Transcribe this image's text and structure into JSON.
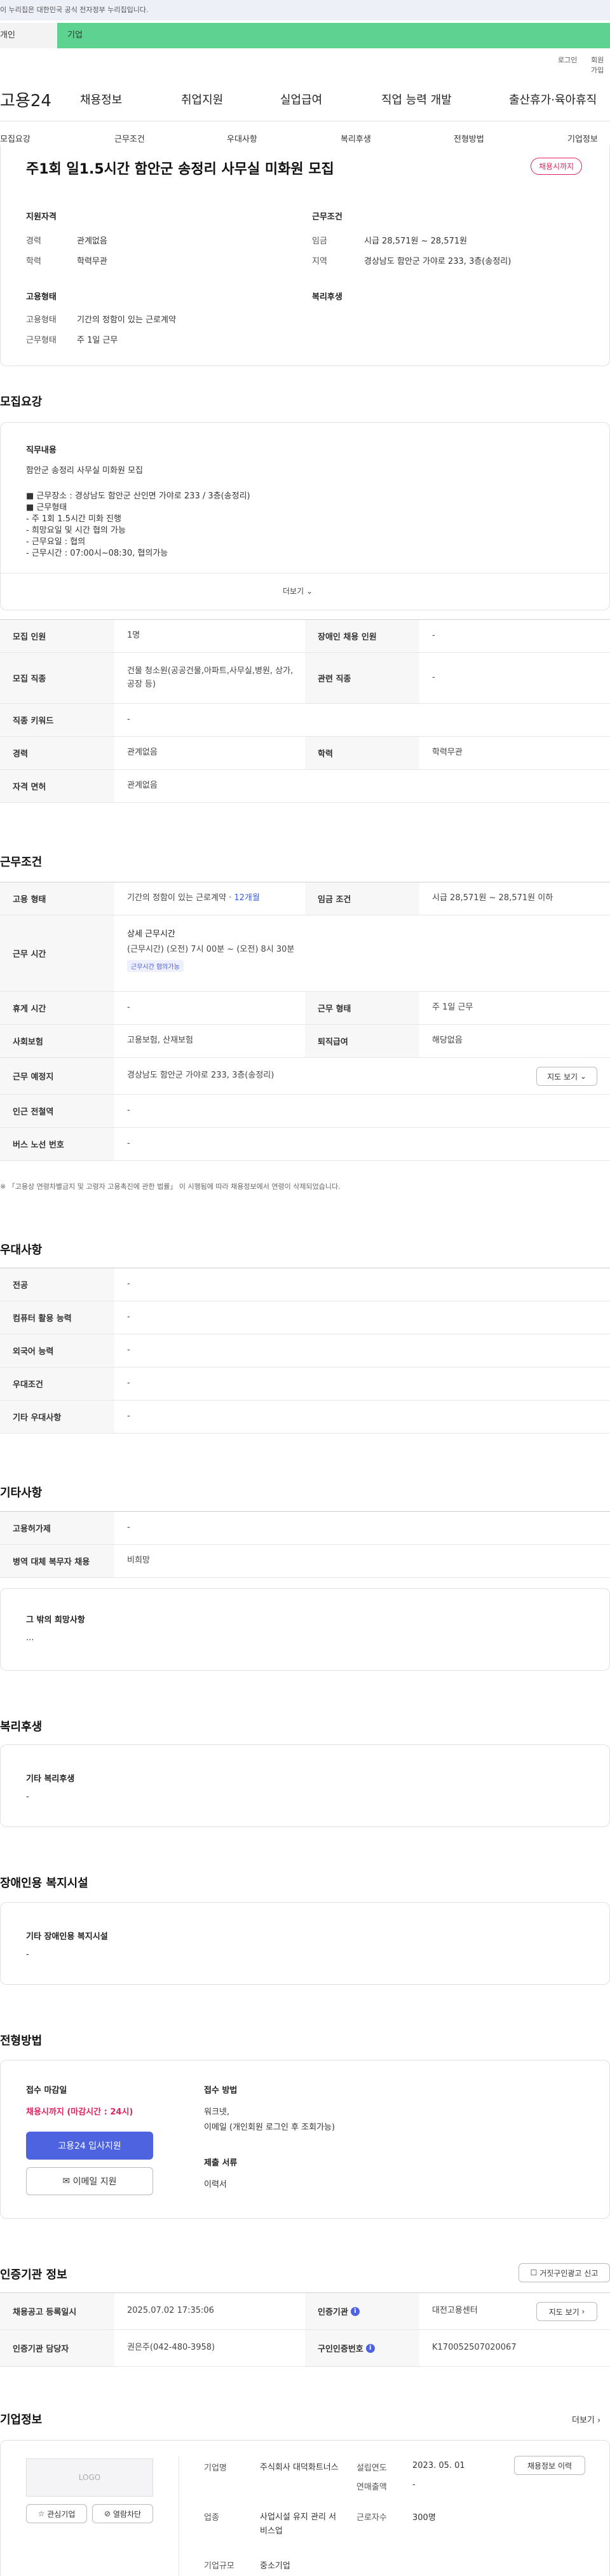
{
  "gov_banner": "이 누리집은 대한민국 공식 전자정부 누리집입니다.",
  "top_tabs": [
    "개인",
    "기업"
  ],
  "util": {
    "login": "로그인",
    "signup": "회원가입"
  },
  "logo": "고용24",
  "gnb": [
    "채용정보",
    "취업지원",
    "실업급여",
    "직업 능력 개발",
    "출산휴가·육아휴직"
  ],
  "sub_tabs": [
    "모집요강",
    "근무조건",
    "우대사항",
    "복리후생",
    "전형방법",
    "기업정보"
  ],
  "job": {
    "title": "주1회 일1.5시간 함안군 송정리 사무실 미화원 모집",
    "badge": "채용시까지",
    "summary": {
      "qual_head": "지원자격",
      "qual": [
        {
          "k": "경력",
          "v": "관계없음"
        },
        {
          "k": "학력",
          "v": "학력무관"
        }
      ],
      "cond_head": "근무조건",
      "cond": [
        {
          "k": "임금",
          "v": "시급 28,571원 ~ 28,571원"
        },
        {
          "k": "지역",
          "v": "경상남도 함안군 가야로 233, 3층(송정리)"
        }
      ],
      "emp_head": "고용형태",
      "emp": [
        {
          "k": "고용형태",
          "v": "기간의 정함이 있는 근로계약"
        },
        {
          "k": "근무형태",
          "v": "주 1일 근무"
        }
      ],
      "welfare_head": "복리후생"
    }
  },
  "recruit": {
    "title": "모집요강",
    "duty_head": "직무내용",
    "duty_lines": [
      "함안군 송정리 사무실 미화원 모집",
      "",
      "■ 근무장소 : 경상남도 함안군 산인면 가야로 233 / 3층(송정리)",
      "■ 근무형태",
      "- 주 1회 1.5시간 미화 진행",
      "- 희망요일 및 시간 협의 가능",
      "- 근무요일 : 협의",
      "- 근무시간 : 07:00시~08:30, 협의가능"
    ],
    "more": "더보기",
    "rows": [
      {
        "k1": "모집 인원",
        "v1": "1명",
        "k2": "장애인 채용 인원",
        "v2": "-"
      },
      {
        "k1": "모집 직종",
        "v1": "건물 청소원(공공건물,아파트,사무실,병원, 상가,공장 등)",
        "k2": "관련 직종",
        "v2": "-"
      },
      {
        "k1": "직종 키워드",
        "v1": "-"
      },
      {
        "k1": "경력",
        "v1": "관계없음",
        "k2": "학력",
        "v2": "학력무관"
      },
      {
        "k1": "자격 면허",
        "v1": "관계없음"
      }
    ]
  },
  "conditions": {
    "title": "근무조건",
    "emp_type_k": "고용 형태",
    "emp_type_v": "기간의 정함이 있는 근로계약",
    "emp_type_dur": "12개월",
    "wage_k": "임금 조건",
    "wage_v": "시급 28,571원 ~ 28,571원 이하",
    "hours_k": "근무 시간",
    "hours_head": "상세 근무시간",
    "hours_v": "(근무시간) (오전) 7시 00분 ~ (오전) 8시 30분",
    "hours_tag": "근무시간 협의가능",
    "rest_k": "휴게 시간",
    "rest_v": "-",
    "shift_k": "근무 형태",
    "shift_v": "주 1일 근무",
    "ins_k": "사회보험",
    "ins_v": "고용보험, 산재보험",
    "sev_k": "퇴직급여",
    "sev_v": "해당없음",
    "loc_k": "근무 예정지",
    "loc_v": "경상남도 함안군 가야로 233, 3층(송정리)",
    "map_btn": "지도 보기",
    "subway_k": "인근 전철역",
    "subway_v": "-",
    "bus_k": "버스 노선 번호",
    "bus_v": "-",
    "note": "※ 「고용상 연령차별금지 및 고령자 고용촉진에 관한 법률」 이 시행됨에 따라 채용정보에서 연령이 삭제되었습니다."
  },
  "prefer": {
    "title": "우대사항",
    "rows": [
      {
        "k": "전공",
        "v": "-"
      },
      {
        "k": "컴퓨터 활용 능력",
        "v": "-"
      },
      {
        "k": "외국어 능력",
        "v": "-"
      },
      {
        "k": "우대조건",
        "v": "-"
      },
      {
        "k": "기타 우대사항",
        "v": "-"
      }
    ]
  },
  "etc": {
    "title": "기타사항",
    "rows": [
      {
        "k": "고용허가제",
        "v": "-"
      },
      {
        "k": "병역 대체 복무자 채용",
        "v": "비희망"
      }
    ],
    "box_head": "그 밖의 희망사항",
    "box_v": "..."
  },
  "welfare": {
    "title": "복리후생",
    "head": "기타 복리후생",
    "v": "-"
  },
  "disabled": {
    "title": "장애인용 복지시설",
    "head": "기타 장애인용 복지시설",
    "v": "-"
  },
  "process": {
    "title": "전형방법",
    "deadline_head": "접수 마감일",
    "deadline_v": "채용시까지 (마감시간 : 24시)",
    "apply_btn": "고용24 입사지원",
    "email_btn": "이메일 지원",
    "method_head": "접수 방법",
    "method_v1": "워크넷,",
    "method_v2": "이메일 (개인회원 로그인 후 조회가능)",
    "docs_head": "제출 서류",
    "docs_v": "이력서"
  },
  "agency": {
    "title": "인증기관 정보",
    "report_btn": "거짓구인광고 신고",
    "r1k1": "채용공고 등록일시",
    "r1v1": "2025.07.02 17:35:06",
    "r1k2": "인증기관",
    "r1v2": "대전고용센터",
    "map_btn": "지도 보기",
    "r2k1": "인증기관 담당자",
    "r2v1": "권은주(042-480-3958)",
    "r2k2": "구인인증번호",
    "r2v2": "K170052507020067"
  },
  "company": {
    "title": "기업정보",
    "more": "더보기",
    "logo_text": "LOGO",
    "fav_btn": "관심기업",
    "block_btn": "열람차단",
    "name_k": "기업명",
    "name_v": "주식회사 대덕화트너스",
    "ind_k": "업종",
    "ind_v": "사업시설 유지 관리 서비스업",
    "scale_k": "기업규모",
    "scale_v": "중소기업",
    "est_k": "설립연도",
    "est_v": "2023. 05. 01",
    "sales_k": "연매출액",
    "sales_v": "-",
    "emp_k": "근로자수",
    "emp_v": "300명",
    "hire_btn": "채용정보 이력"
  }
}
